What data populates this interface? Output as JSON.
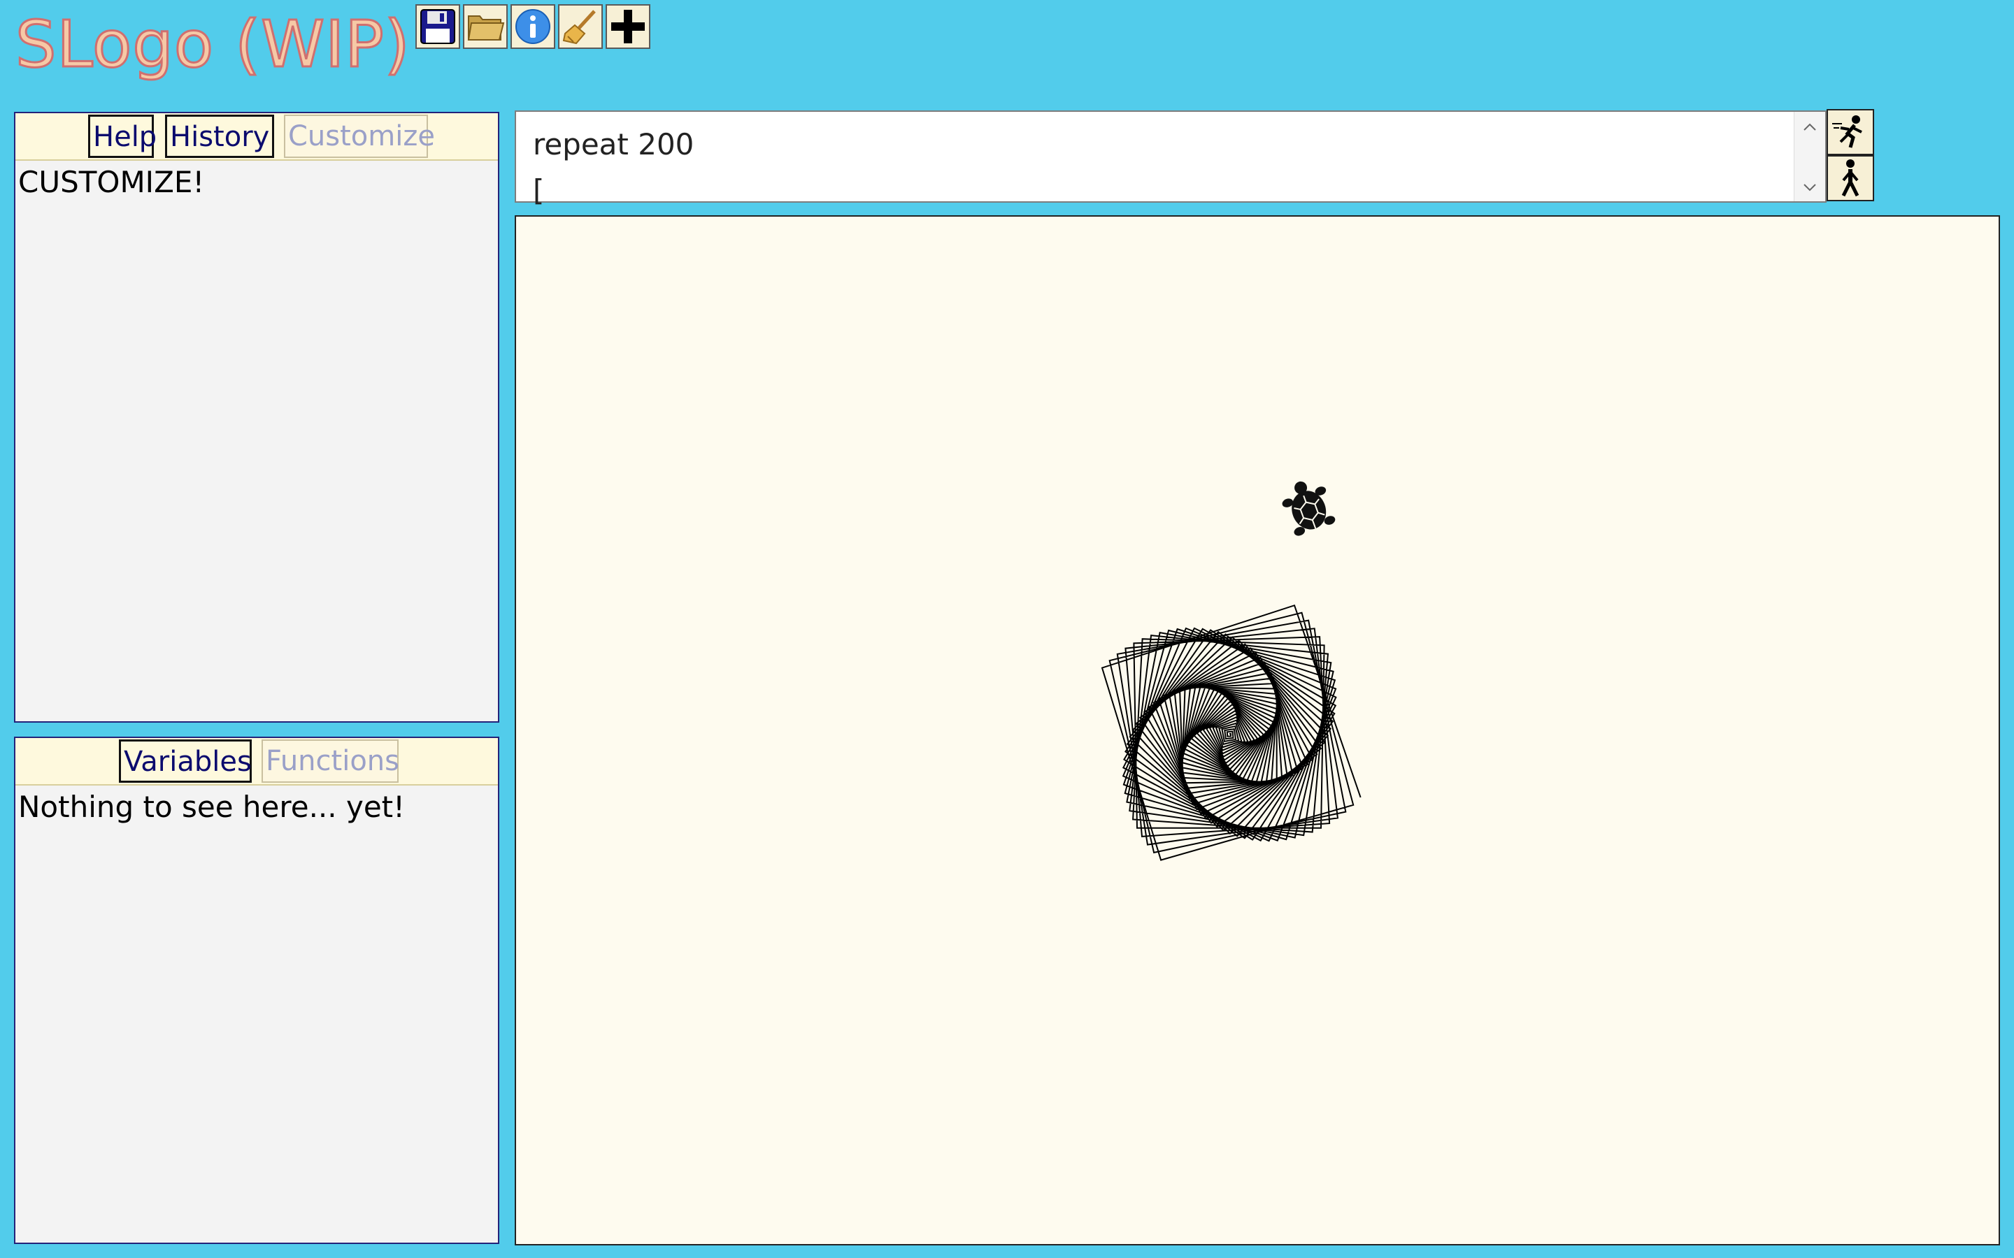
{
  "app": {
    "title": "SLogo (WIP)"
  },
  "toolbar": {
    "items": [
      {
        "icon": "save-icon"
      },
      {
        "icon": "folder-open-icon"
      },
      {
        "icon": "info-icon"
      },
      {
        "icon": "broom-icon"
      },
      {
        "icon": "plus-icon"
      }
    ]
  },
  "top_panel": {
    "tabs": [
      {
        "label": "Help",
        "active": true
      },
      {
        "label": "History",
        "active": true
      },
      {
        "label": "Customize",
        "active": false
      }
    ],
    "content": "CUSTOMIZE!"
  },
  "bottom_panel": {
    "tabs": [
      {
        "label": "Variables",
        "active": true
      },
      {
        "label": "Functions",
        "active": false
      }
    ],
    "content": "Nothing to see here... yet!"
  },
  "command": {
    "lines": [
      "repeat 200",
      "["
    ]
  },
  "run_buttons": [
    {
      "icon": "run-icon"
    },
    {
      "icon": "step-walk-icon"
    }
  ],
  "colors": {
    "background": "#52cceb",
    "canvas": "#fefbef",
    "active_tab_text": "#0b0b6e",
    "inactive_tab_text": "#9aa0c8",
    "title_fill": "#f6c9a6"
  }
}
